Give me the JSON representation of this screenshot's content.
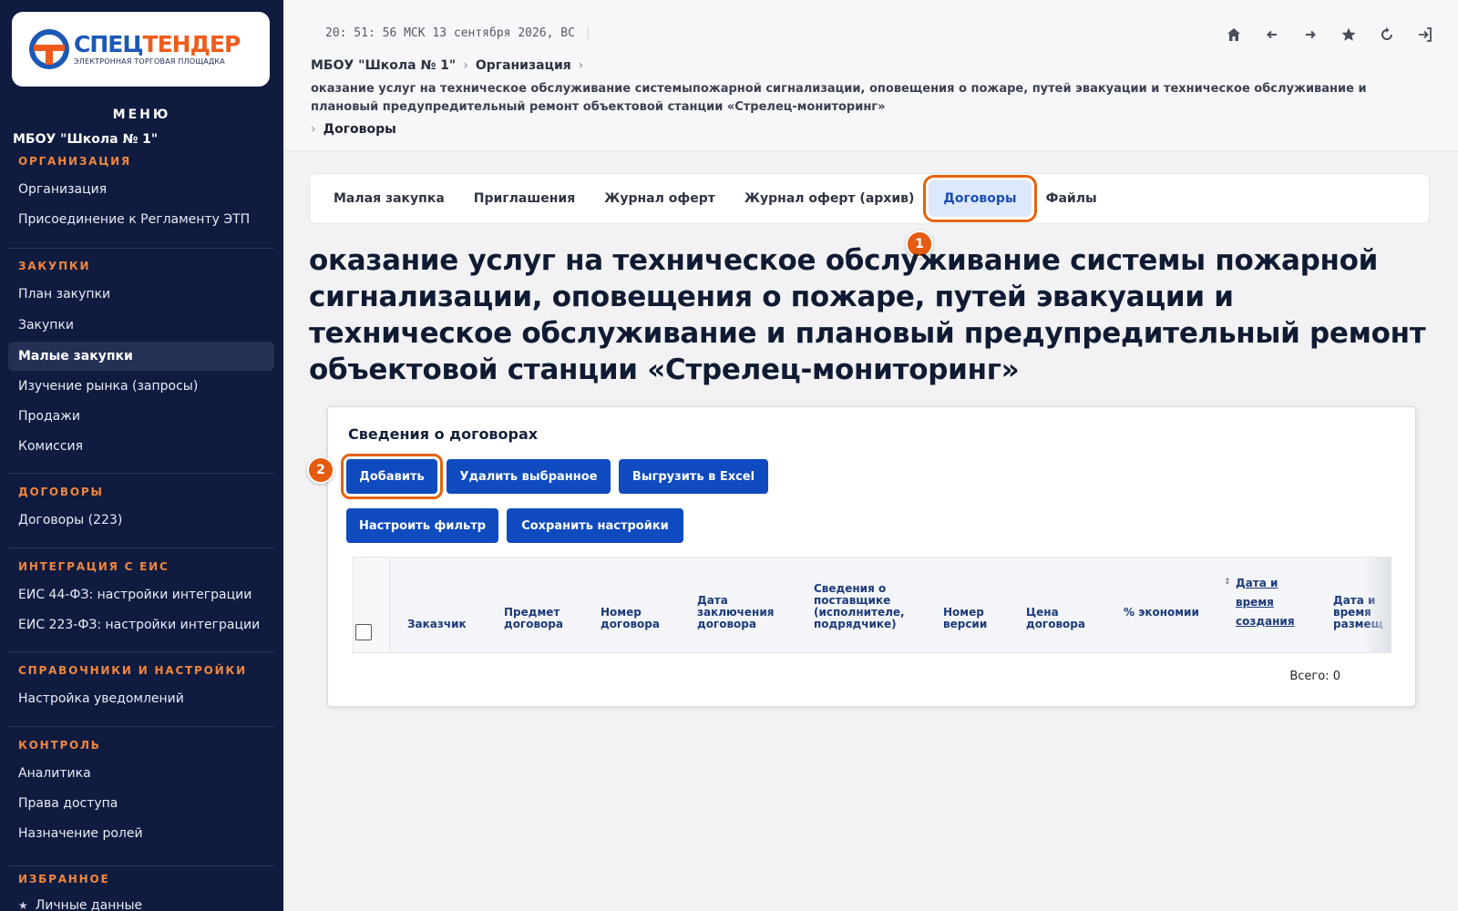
{
  "logo": {
    "name_part1": "СПЕЦ",
    "name_part2": "ТЕНДЕР",
    "subtitle": "ЭЛЕКТРОННАЯ ТОРГОВАЯ ПЛОЩАДКА"
  },
  "sidebar": {
    "menu_title": "МЕНЮ",
    "org_name": "МБОУ \"Школа № 1\"",
    "sections": [
      {
        "title": "ОРГАНИЗАЦИЯ",
        "items": [
          {
            "label": "Организация"
          },
          {
            "label": "Присоединение к Регламенту ЭТП"
          }
        ]
      },
      {
        "title": "ЗАКУПКИ",
        "items": [
          {
            "label": "План закупки"
          },
          {
            "label": "Закупки"
          },
          {
            "label": "Малые закупки",
            "active": true
          },
          {
            "label": "Изучение рынка (запросы)"
          },
          {
            "label": "Продажи"
          },
          {
            "label": "Комиссия"
          }
        ]
      },
      {
        "title": "ДОГОВОРЫ",
        "items": [
          {
            "label": "Договоры (223)"
          }
        ]
      },
      {
        "title": "ИНТЕГРАЦИЯ С ЕИС",
        "items": [
          {
            "label": "ЕИС 44-ФЗ: настройки интеграции"
          },
          {
            "label": "ЕИС 223-ФЗ: настройки интеграции"
          }
        ]
      },
      {
        "title": "СПРАВОЧНИКИ И НАСТРОЙКИ",
        "items": [
          {
            "label": "Настройка уведомлений"
          }
        ]
      },
      {
        "title": "КОНТРОЛЬ",
        "items": [
          {
            "label": "Аналитика"
          },
          {
            "label": "Права доступа"
          },
          {
            "label": "Назначение ролей"
          }
        ]
      },
      {
        "title": "ИЗБРАННОЕ",
        "items": [
          {
            "label": "Личные данные"
          }
        ]
      }
    ]
  },
  "topbar": {
    "clock": "20: 51: 56 МСК  13 сентября 2026, ВС",
    "icons": [
      "home-icon",
      "back-arrow-icon",
      "forward-arrow-icon",
      "star-icon",
      "refresh-icon",
      "logout-icon"
    ]
  },
  "breadcrumb": {
    "org": "МБОУ \"Школа № 1\"",
    "section": "Организация",
    "procurement": "оказание услуг на техническое обслуживание системыпожарной сигнализации, оповещения о пожаре, путей эвакуации и техническое обслуживание и плановый предупредительный ремонт объектовой станции «Стрелец-мониторинг»",
    "current": "Договоры"
  },
  "tabs": [
    {
      "label": "Малая закупка"
    },
    {
      "label": "Приглашения"
    },
    {
      "label": "Журнал оферт"
    },
    {
      "label": "Журнал оферт (архив)"
    },
    {
      "label": "Договоры",
      "active": true
    },
    {
      "label": "Файлы"
    }
  ],
  "markers": {
    "tab": "1",
    "add": "2"
  },
  "page_title": "оказание услуг на техническое обслуживание системы пожарной сигнализации, оповещения о пожаре, путей эвакуации и техническое обслуживание и плановый предупредительный ремонт объектовой станции «Стрелец-мониторинг»",
  "card": {
    "title": "Сведения о договорах",
    "buttons": {
      "add": "Добавить",
      "delete_selected": "Удалить выбранное",
      "export_excel": "Выгрузить в Excel",
      "filter": "Настроить фильтр",
      "save_settings": "Сохранить настройки"
    },
    "columns": [
      "Заказчик",
      "Предмет договора",
      "Номер договора",
      "Дата заключения договора",
      "Сведения о поставщике (исполнителе, подрядчике)",
      "Номер версии",
      "Цена договора",
      "% экономии",
      "Дата и время создания",
      "Дата и время размещ"
    ],
    "total": "Всего: 0"
  },
  "colors": {
    "sidebar_bg": "#0f1b3f",
    "accent_orange": "#e8620f",
    "button_blue": "#0f4bbf",
    "section_orange": "#f0863e"
  }
}
